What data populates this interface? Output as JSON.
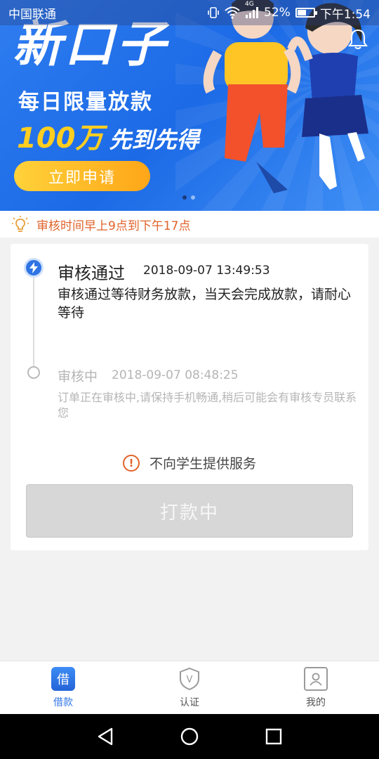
{
  "status_bar": {
    "carrier": "中国联通",
    "network": "4G",
    "battery": "52%",
    "time": "下午1:54"
  },
  "banner": {
    "title": "新口子",
    "subtitle1": "每日限量放款",
    "amount": "100万",
    "subtitle2": "先到先得",
    "apply_button": "立即申请",
    "slides_total": 2,
    "active_slide": 1
  },
  "notice": {
    "text": "审核时间早上9点到下午17点"
  },
  "progress": {
    "step1": {
      "title": "审核通过",
      "time": "2018-09-07 13:49:53",
      "desc": "审核通过等待财务放款，当天会完成放款，请耐心等待"
    },
    "step2": {
      "title": "审核中",
      "time": "2018-09-07 08:48:25",
      "desc": "订单正在审核中,请保持手机畅通,稍后可能会有审核专员联系您"
    }
  },
  "warning": {
    "icon": "!",
    "text": "不向学生提供服务"
  },
  "pay_button": "打款中",
  "bottom_nav": {
    "items": [
      {
        "label": "借款",
        "icon": "借"
      },
      {
        "label": "认证",
        "icon": "V"
      },
      {
        "label": "我的",
        "icon": "user-icon"
      }
    ]
  },
  "colors": {
    "accent": "#2f74e4",
    "notice": "#e0622a",
    "banner_yellow": "#ffce20"
  }
}
